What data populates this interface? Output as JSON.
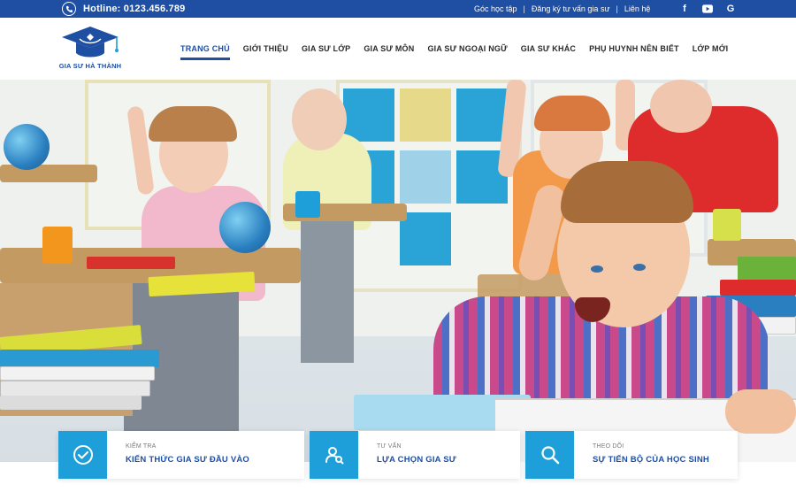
{
  "topbar": {
    "hotline": "Hotline: 0123.456.789",
    "links": [
      "Góc học tập",
      "Đăng ký tư vấn gia sư",
      "Liên hệ"
    ],
    "social": [
      {
        "name": "facebook-icon",
        "glyph": "f"
      },
      {
        "name": "youtube-icon",
        "glyph": "▶"
      },
      {
        "name": "google-icon",
        "glyph": "G"
      }
    ]
  },
  "logo": {
    "text": "GIA SƯ HÀ THÀNH"
  },
  "nav": {
    "items": [
      "TRANG CHỦ",
      "GIỚI THIỆU",
      "GIA SƯ LỚP",
      "GIA SƯ MÔN",
      "GIA SƯ NGOẠI NGỮ",
      "GIA SƯ KHÁC",
      "PHỤ HUYNH NÊN BIẾT",
      "LỚP MỚI"
    ],
    "active": "TRANG CHỦ"
  },
  "features": [
    {
      "sub": "KIỂM TRA",
      "title": "KIẾN THỨC GIA SƯ ĐẦU VÀO",
      "icon": "check-circle-icon"
    },
    {
      "sub": "TƯ VẤN",
      "title": "LỰA CHỌN GIA SƯ",
      "icon": "user-search-icon"
    },
    {
      "sub": "THEO DÕI",
      "title": "SỰ TIẾN BỘ CỦA HỌC SINH",
      "icon": "search-icon"
    }
  ],
  "colors": {
    "primary": "#1f4fa3",
    "accent": "#1e9fd9"
  }
}
